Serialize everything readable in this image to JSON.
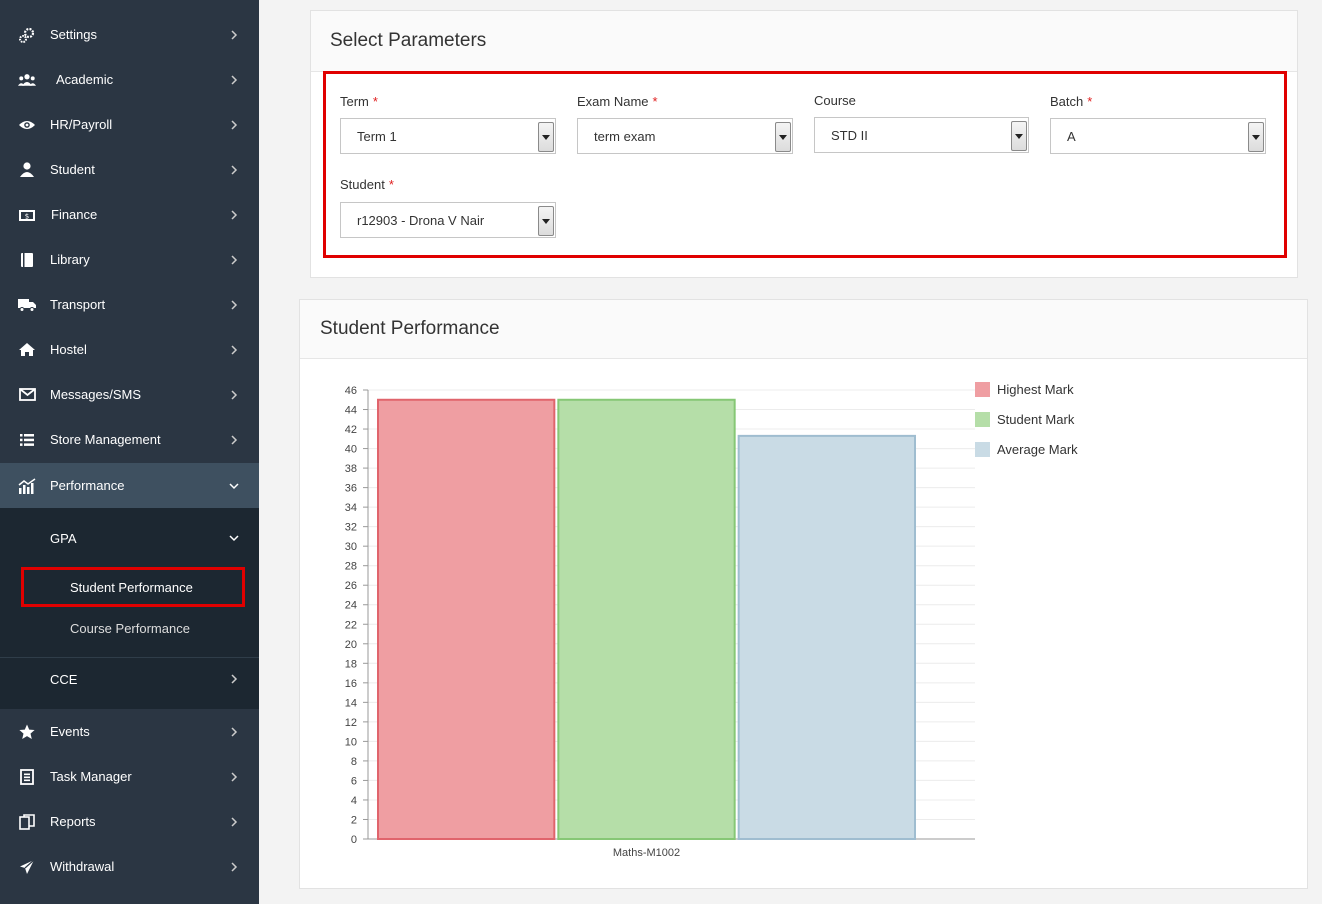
{
  "sidebar": {
    "items": [
      {
        "label": "Settings",
        "icon": "gears-icon"
      },
      {
        "label": "Academic",
        "icon": "users-icon"
      },
      {
        "label": "HR/Payroll",
        "icon": "eye-icon"
      },
      {
        "label": "Student",
        "icon": "user-icon"
      },
      {
        "label": "Finance",
        "icon": "money-icon"
      },
      {
        "label": "Library",
        "icon": "book-icon"
      },
      {
        "label": "Transport",
        "icon": "truck-icon"
      },
      {
        "label": "Hostel",
        "icon": "home-icon"
      },
      {
        "label": "Messages/SMS",
        "icon": "envelope-icon"
      },
      {
        "label": "Store Management",
        "icon": "list-icon"
      },
      {
        "label": "Performance",
        "icon": "chart-icon"
      }
    ],
    "performance_sub": {
      "gpa": "GPA",
      "student_performance": "Student Performance",
      "course_performance": "Course Performance",
      "cce": "CCE"
    },
    "bottom_items": [
      {
        "label": "Events",
        "icon": "star-icon"
      },
      {
        "label": "Task Manager",
        "icon": "task-icon"
      },
      {
        "label": "Reports",
        "icon": "copy-icon"
      },
      {
        "label": "Withdrawal",
        "icon": "send-icon"
      }
    ]
  },
  "params": {
    "title": "Select Parameters",
    "term": {
      "label": "Term",
      "value": "Term 1"
    },
    "exam": {
      "label": "Exam Name",
      "value": "term exam"
    },
    "course": {
      "label": "Course",
      "value": "STD II"
    },
    "batch": {
      "label": "Batch",
      "value": "A"
    },
    "student": {
      "label": "Student",
      "value": "r12903 - Drona V Nair"
    },
    "required_mark": "*"
  },
  "performance": {
    "title": "Student Performance"
  },
  "colors": {
    "sidebar_bg": "#2b3643",
    "highest": "#ef9ea2",
    "student": "#b5dea8",
    "average": "#c9dbe5",
    "highlight": "#e00000"
  },
  "chart_data": {
    "type": "bar",
    "categories": [
      "Maths-M1002"
    ],
    "series": [
      {
        "name": "Highest Mark",
        "values": [
          45
        ]
      },
      {
        "name": "Student Mark",
        "values": [
          45
        ]
      },
      {
        "name": "Average Mark",
        "values": [
          41.3
        ]
      }
    ],
    "ylim": [
      0,
      46
    ],
    "yticks": [
      0,
      2,
      4,
      6,
      8,
      10,
      12,
      14,
      16,
      18,
      20,
      22,
      24,
      26,
      28,
      30,
      32,
      34,
      36,
      38,
      40,
      42,
      44,
      46
    ],
    "legend": "right",
    "grid": true
  }
}
